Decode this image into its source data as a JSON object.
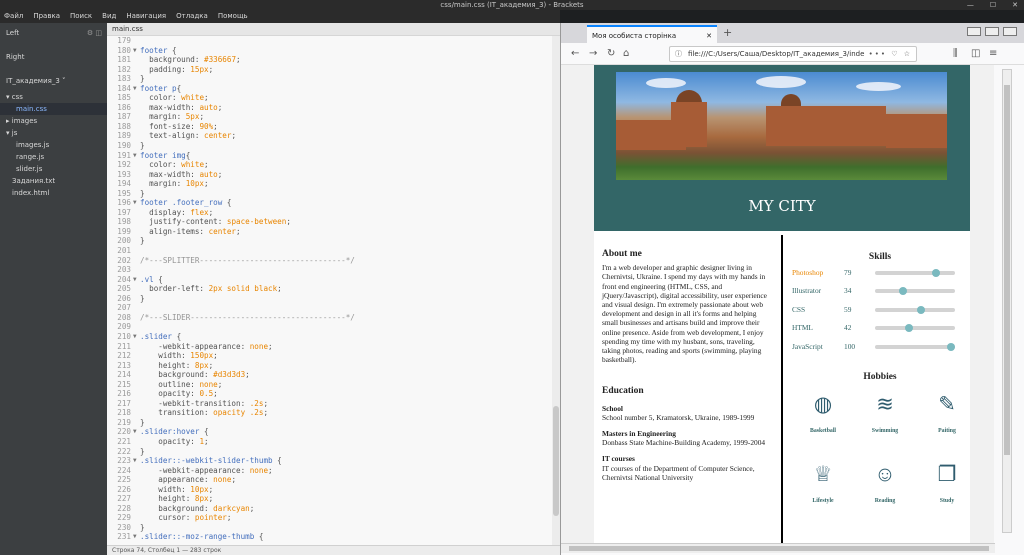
{
  "window": {
    "title": "css/main.css (IT_академия_3) - Brackets"
  },
  "menu": [
    "Файл",
    "Правка",
    "Поиск",
    "Вид",
    "Навигация",
    "Отладка",
    "Помощь"
  ],
  "sidebar": {
    "left_label": "Left",
    "right_label": "Right",
    "project": "IT_академия_3 ˅",
    "tree": [
      "css",
      "main.css",
      "images",
      "js",
      "images.js",
      "range.js",
      "slider.js",
      "Задания.txt",
      "index.html"
    ]
  },
  "editor": {
    "tab": "main.css",
    "status": "Строка 74, Столбец 1 — 283 строк",
    "lines": [
      {
        "n": "179",
        "f": "",
        "t": []
      },
      {
        "n": "180",
        "f": "▼",
        "t": [
          [
            "k",
            "footer "
          ],
          [
            "",
            "{"
          ]
        ]
      },
      {
        "n": "181",
        "f": "",
        "t": [
          [
            "",
            "  background: "
          ],
          [
            "v",
            "#336667"
          ],
          [
            "",
            ";"
          ]
        ]
      },
      {
        "n": "182",
        "f": "",
        "t": [
          [
            "",
            "  padding: "
          ],
          [
            "v",
            "15px"
          ],
          [
            "",
            ";"
          ]
        ]
      },
      {
        "n": "183",
        "f": "",
        "t": [
          [
            "",
            "}"
          ]
        ]
      },
      {
        "n": "184",
        "f": "▼",
        "t": [
          [
            "k",
            "footer p"
          ],
          [
            "",
            "{"
          ]
        ]
      },
      {
        "n": "185",
        "f": "",
        "t": [
          [
            "",
            "  color: "
          ],
          [
            "v",
            "white"
          ],
          [
            "",
            ";"
          ]
        ]
      },
      {
        "n": "186",
        "f": "",
        "t": [
          [
            "",
            "  max-width: "
          ],
          [
            "v",
            "auto"
          ],
          [
            "",
            ";"
          ]
        ]
      },
      {
        "n": "187",
        "f": "",
        "t": [
          [
            "",
            "  margin: "
          ],
          [
            "v",
            "5px"
          ],
          [
            "",
            ";"
          ]
        ]
      },
      {
        "n": "188",
        "f": "",
        "t": [
          [
            "",
            "  font-size: "
          ],
          [
            "v",
            "90%"
          ],
          [
            "",
            ";"
          ]
        ]
      },
      {
        "n": "189",
        "f": "",
        "t": [
          [
            "",
            "  text-align: "
          ],
          [
            "v",
            "center"
          ],
          [
            "",
            ";"
          ]
        ]
      },
      {
        "n": "190",
        "f": "",
        "t": [
          [
            "",
            "}"
          ]
        ]
      },
      {
        "n": "191",
        "f": "▼",
        "t": [
          [
            "k",
            "footer img"
          ],
          [
            "",
            "{"
          ]
        ]
      },
      {
        "n": "192",
        "f": "",
        "t": [
          [
            "",
            "  color: "
          ],
          [
            "v",
            "white"
          ],
          [
            "",
            ";"
          ]
        ]
      },
      {
        "n": "193",
        "f": "",
        "t": [
          [
            "",
            "  max-width: "
          ],
          [
            "v",
            "auto"
          ],
          [
            "",
            ";"
          ]
        ]
      },
      {
        "n": "194",
        "f": "",
        "t": [
          [
            "",
            "  margin: "
          ],
          [
            "v",
            "10px"
          ],
          [
            "",
            ";"
          ]
        ]
      },
      {
        "n": "195",
        "f": "",
        "t": [
          [
            "",
            "}"
          ]
        ]
      },
      {
        "n": "196",
        "f": "▼",
        "t": [
          [
            "k",
            "footer .footer_row "
          ],
          [
            "",
            "{"
          ]
        ]
      },
      {
        "n": "197",
        "f": "",
        "t": [
          [
            "",
            "  display: "
          ],
          [
            "v",
            "flex"
          ],
          [
            "",
            ";"
          ]
        ]
      },
      {
        "n": "198",
        "f": "",
        "t": [
          [
            "",
            "  justify-content: "
          ],
          [
            "v",
            "space-between"
          ],
          [
            "",
            ";"
          ]
        ]
      },
      {
        "n": "199",
        "f": "",
        "t": [
          [
            "",
            "  align-items: "
          ],
          [
            "v",
            "center"
          ],
          [
            "",
            ";"
          ]
        ]
      },
      {
        "n": "200",
        "f": "",
        "t": [
          [
            "",
            "}"
          ]
        ]
      },
      {
        "n": "201",
        "f": "",
        "t": []
      },
      {
        "n": "202",
        "f": "",
        "t": [
          [
            "c",
            "/*---SPLITTER--------------------------------*/"
          ]
        ]
      },
      {
        "n": "203",
        "f": "",
        "t": []
      },
      {
        "n": "204",
        "f": "▼",
        "t": [
          [
            "k",
            ".vl "
          ],
          [
            "",
            "{"
          ]
        ]
      },
      {
        "n": "205",
        "f": "",
        "t": [
          [
            "",
            "  border-left: "
          ],
          [
            "v",
            "2px solid black"
          ],
          [
            "",
            ";"
          ]
        ]
      },
      {
        "n": "206",
        "f": "",
        "t": [
          [
            "",
            "}"
          ]
        ]
      },
      {
        "n": "207",
        "f": "",
        "t": []
      },
      {
        "n": "208",
        "f": "",
        "t": [
          [
            "c",
            "/*---SLIDER----------------------------------*/"
          ]
        ]
      },
      {
        "n": "209",
        "f": "",
        "t": []
      },
      {
        "n": "210",
        "f": "▼",
        "t": [
          [
            "k",
            ".slider "
          ],
          [
            "",
            "{"
          ]
        ]
      },
      {
        "n": "211",
        "f": "",
        "t": [
          [
            "",
            "    -webkit-appearance: "
          ],
          [
            "v",
            "none"
          ],
          [
            "",
            ";"
          ]
        ]
      },
      {
        "n": "212",
        "f": "",
        "t": [
          [
            "",
            "    width: "
          ],
          [
            "v",
            "150px"
          ],
          [
            "",
            ";"
          ]
        ]
      },
      {
        "n": "213",
        "f": "",
        "t": [
          [
            "",
            "    height: "
          ],
          [
            "v",
            "8px"
          ],
          [
            "",
            ";"
          ]
        ]
      },
      {
        "n": "214",
        "f": "",
        "t": [
          [
            "",
            "    background: "
          ],
          [
            "v",
            "#d3d3d3"
          ],
          [
            "",
            ";"
          ]
        ]
      },
      {
        "n": "215",
        "f": "",
        "t": [
          [
            "",
            "    outline: "
          ],
          [
            "v",
            "none"
          ],
          [
            "",
            ";"
          ]
        ]
      },
      {
        "n": "216",
        "f": "",
        "t": [
          [
            "",
            "    opacity: "
          ],
          [
            "v",
            "0.5"
          ],
          [
            "",
            ";"
          ]
        ]
      },
      {
        "n": "217",
        "f": "",
        "t": [
          [
            "",
            "    -webkit-transition: "
          ],
          [
            "v",
            ".2s"
          ],
          [
            "",
            ";"
          ]
        ]
      },
      {
        "n": "218",
        "f": "",
        "t": [
          [
            "",
            "    transition: "
          ],
          [
            "v",
            "opacity .2s"
          ],
          [
            "",
            ";"
          ]
        ]
      },
      {
        "n": "219",
        "f": "",
        "t": [
          [
            "",
            "}"
          ]
        ]
      },
      {
        "n": "220",
        "f": "▼",
        "t": [
          [
            "k",
            ".slider:hover "
          ],
          [
            "",
            "{"
          ]
        ]
      },
      {
        "n": "221",
        "f": "",
        "t": [
          [
            "",
            "    opacity: "
          ],
          [
            "v",
            "1"
          ],
          [
            "",
            ";"
          ]
        ]
      },
      {
        "n": "222",
        "f": "",
        "t": [
          [
            "",
            "}"
          ]
        ]
      },
      {
        "n": "223",
        "f": "▼",
        "t": [
          [
            "k",
            ".slider::-webkit-slider-thumb "
          ],
          [
            "",
            "{"
          ]
        ]
      },
      {
        "n": "224",
        "f": "",
        "t": [
          [
            "",
            "    -webkit-appearance: "
          ],
          [
            "v",
            "none"
          ],
          [
            "",
            ";"
          ]
        ]
      },
      {
        "n": "225",
        "f": "",
        "t": [
          [
            "",
            "    appearance: "
          ],
          [
            "v",
            "none"
          ],
          [
            "",
            ";"
          ]
        ]
      },
      {
        "n": "226",
        "f": "",
        "t": [
          [
            "",
            "    width: "
          ],
          [
            "v",
            "10px"
          ],
          [
            "",
            ";"
          ]
        ]
      },
      {
        "n": "227",
        "f": "",
        "t": [
          [
            "",
            "    height: "
          ],
          [
            "v",
            "8px"
          ],
          [
            "",
            ";"
          ]
        ]
      },
      {
        "n": "228",
        "f": "",
        "t": [
          [
            "",
            "    background: "
          ],
          [
            "v",
            "darkcyan"
          ],
          [
            "",
            ";"
          ]
        ]
      },
      {
        "n": "229",
        "f": "",
        "t": [
          [
            "",
            "    cursor: "
          ],
          [
            "v",
            "pointer"
          ],
          [
            "",
            ";"
          ]
        ]
      },
      {
        "n": "230",
        "f": "",
        "t": [
          [
            "",
            "}"
          ]
        ]
      },
      {
        "n": "231",
        "f": "▼",
        "t": [
          [
            "k",
            ".slider::-moz-range-thumb "
          ],
          [
            "",
            "{"
          ]
        ]
      }
    ]
  },
  "browser": {
    "tab": "Моя особиста сторінка",
    "url": "file:///C:/Users/Саша/Desktop/IT_академия_3/inde",
    "url_actions": "••• ♡ ☆"
  },
  "site": {
    "title": "MY CITY",
    "about_heading": "About me",
    "about_text": "I'm a web developer and graphic designer living in Chernivtsi, Ukraine. I spend my days with my hands in front end engineering (HTML, CSS, and jQuery/Javascript), digital accessibility, user experience and visual design. I'm extremely passionate about web development and design in all it's forms and helping small businesses and artisans build and improve their online presence. Aside from web development, I enjoy spending my time with my husbant, sons, traveling, taking photos, reading and sports (swimming, playing basketball).",
    "education_heading": "Education",
    "education": [
      {
        "title": "School",
        "text": "School number 5, Kramatorsk, Ukraine, 1989-1999"
      },
      {
        "title": "Masters in Engineering",
        "text": "Donbass State Machine-Building Academy, 1999-2004"
      },
      {
        "title": "IT courses",
        "text": "IT courses of the Department of Computer Science, Chernivtsi National University"
      }
    ],
    "skills_heading": "Skills",
    "skills": [
      {
        "name": "Photoshop",
        "value": "79",
        "frac": 0.79,
        "color": "#e88501"
      },
      {
        "name": "Illustrator",
        "value": "34",
        "frac": 0.34,
        "color": "#336667"
      },
      {
        "name": "CSS",
        "value": "59",
        "frac": 0.59,
        "color": "#336667"
      },
      {
        "name": "HTML",
        "value": "42",
        "frac": 0.42,
        "color": "#336667"
      },
      {
        "name": "JavaScript",
        "value": "100",
        "frac": 1.0,
        "color": "#336667"
      }
    ],
    "hobbies_heading": "Hobbies",
    "hobbies": [
      {
        "label": "Basketball",
        "icon": "basketball-icon",
        "glyph": "◍"
      },
      {
        "label": "Swimming",
        "icon": "swimmer-icon",
        "glyph": "≋"
      },
      {
        "label": "Paiting",
        "icon": "palette-icon",
        "glyph": "✎"
      },
      {
        "label": "Lifestyle",
        "icon": "wine-glasses-icon",
        "glyph": "♕"
      },
      {
        "label": "Reading",
        "icon": "reader-icon",
        "glyph": "☺"
      },
      {
        "label": "Study",
        "icon": "book-icon",
        "glyph": "❐"
      }
    ]
  }
}
